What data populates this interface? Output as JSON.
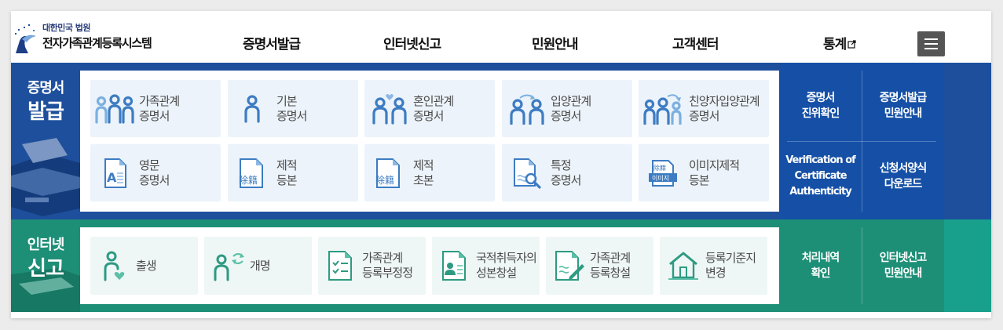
{
  "header": {
    "logo_top": "대한민국 법원",
    "logo_main": "전자가족관계등록시스템",
    "nav": [
      "증명서발급",
      "인터넷신고",
      "민원안내",
      "고객센터",
      "통계"
    ],
    "menu_icon": "hamburger-icon",
    "external_icon": "external-link-icon"
  },
  "certificate": {
    "title_line1": "증명서",
    "title_line2": "발급",
    "items": [
      {
        "label": "가족관계\n증명서",
        "icon": "family-icon"
      },
      {
        "label": "기본\n증명서",
        "icon": "person-icon"
      },
      {
        "label": "혼인관계\n증명서",
        "icon": "marriage-icon"
      },
      {
        "label": "입양관계\n증명서",
        "icon": "adoption-icon"
      },
      {
        "label": "친양자입양관계\n증명서",
        "icon": "full-adoption-icon"
      },
      {
        "label": "영문\n증명서",
        "icon": "english-document-icon"
      },
      {
        "label": "제적\n등본",
        "icon": "removed-register-icon"
      },
      {
        "label": "제적\n초본",
        "icon": "removed-register-icon"
      },
      {
        "label": "특정\n증명서",
        "icon": "document-search-icon"
      },
      {
        "label": "이미지제적\n등본",
        "icon": "image-register-icon"
      }
    ],
    "icon_tags": {
      "removed": "除籍",
      "image": "이미지",
      "image_top": "除籍"
    },
    "side_links": [
      "증명서\n진위확인",
      "증명서발급\n민원안내",
      "Verification of\nCertificate\nAuthenticity",
      "신청서양식\n다운로드"
    ]
  },
  "report": {
    "title_line1": "인터넷",
    "title_line2": "신고",
    "items": [
      {
        "label": "출생",
        "icon": "birth-icon"
      },
      {
        "label": "개명",
        "icon": "rename-icon"
      },
      {
        "label": "가족관계\n등록부정정",
        "icon": "checklist-icon"
      },
      {
        "label": "국적취득자의\n성본창설",
        "icon": "citizen-card-icon"
      },
      {
        "label": "가족관계\n등록창설",
        "icon": "document-edit-icon"
      },
      {
        "label": "등록기준지\n변경",
        "icon": "house-icon"
      }
    ],
    "side_links": [
      "처리내역\n확인",
      "인터넷신고\n민원안내"
    ]
  },
  "colors": {
    "cert_band": "#1e4f9c",
    "cert_side": "#1550a6",
    "report_band": "#1e8f77",
    "report_side": "#18a08c",
    "icon_blue": "#3d7cc2",
    "icon_green": "#2e9a82"
  }
}
